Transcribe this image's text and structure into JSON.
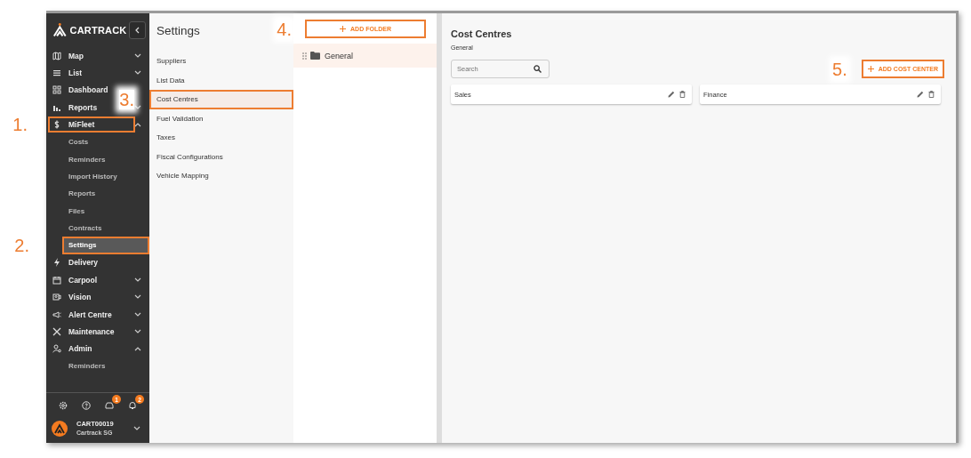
{
  "sidebar": {
    "logo": "CARTRACK",
    "items": [
      {
        "label": "Map",
        "selected": false,
        "expanded": false
      },
      {
        "label": "List",
        "selected": false,
        "expanded": false
      },
      {
        "label": "Dashboard",
        "selected": false
      },
      {
        "label": "Reports",
        "selected": false,
        "expanded": false
      },
      {
        "label": "MiFleet",
        "selected": false,
        "expanded": true,
        "annotation": "1.",
        "children": [
          {
            "label": "Costs",
            "selected": false
          },
          {
            "label": "Reminders",
            "selected": false
          },
          {
            "label": "Import History",
            "selected": false
          },
          {
            "label": "Reports",
            "selected": false
          },
          {
            "label": "Files",
            "selected": false
          },
          {
            "label": "Contracts",
            "selected": false
          },
          {
            "label": "Settings",
            "selected": true,
            "annotation": "2."
          }
        ]
      },
      {
        "label": "Delivery",
        "selected": false
      },
      {
        "label": "Carpool",
        "selected": false,
        "expanded": false
      },
      {
        "label": "Vision",
        "selected": false,
        "expanded": false
      },
      {
        "label": "Alert Centre",
        "selected": false,
        "expanded": false
      },
      {
        "label": "Maintenance",
        "selected": false,
        "expanded": false
      },
      {
        "label": "Admin",
        "selected": false,
        "expanded": true,
        "children": [
          {
            "label": "Reminders",
            "selected": false
          }
        ]
      }
    ],
    "badges": [
      "1",
      "2"
    ],
    "user": {
      "id": "CART00019",
      "company": "Cartrack SG"
    }
  },
  "settings_panel": {
    "title": "Settings",
    "items": [
      {
        "label": "Suppliers",
        "selected": false
      },
      {
        "label": "List Data",
        "selected": false
      },
      {
        "label": "Cost Centres",
        "selected": true,
        "annotation": "3."
      },
      {
        "label": "Fuel Validation",
        "selected": false
      },
      {
        "label": "Taxes",
        "selected": false
      },
      {
        "label": "Fiscal Configurations",
        "selected": false
      },
      {
        "label": "Vehicle Mapping",
        "selected": false
      }
    ]
  },
  "folders": {
    "add_button": {
      "label": "ADD FOLDER",
      "annotation": "4."
    },
    "items": [
      {
        "label": "General",
        "selected": true
      }
    ]
  },
  "content": {
    "title": "Cost Centres",
    "subtitle": "General",
    "search": {
      "placeholder": "Search"
    },
    "add_button": {
      "label": "ADD COST CENTER",
      "annotation": "5."
    },
    "cards": [
      {
        "name": "Sales"
      },
      {
        "name": "Finance"
      }
    ]
  }
}
